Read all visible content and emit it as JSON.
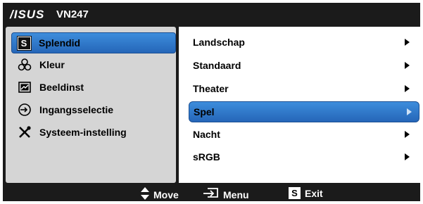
{
  "header": {
    "logo": "/ISUS",
    "model": "VN247"
  },
  "left_menu": {
    "items": [
      {
        "label": "Splendid",
        "icon": "splendid-s-icon",
        "selected": true
      },
      {
        "label": "Kleur",
        "icon": "color-icon",
        "selected": false
      },
      {
        "label": "Beeldinst",
        "icon": "image-icon",
        "selected": false
      },
      {
        "label": "Ingangsselectie",
        "icon": "input-icon",
        "selected": false
      },
      {
        "label": "Systeem-instelling",
        "icon": "tools-icon",
        "selected": false
      }
    ],
    "splendid_glyph": "S"
  },
  "right_menu": {
    "items": [
      {
        "label": "Landschap",
        "selected": false
      },
      {
        "label": "Standaard",
        "selected": false
      },
      {
        "label": "Theater",
        "selected": false
      },
      {
        "label": "Spel",
        "selected": true
      },
      {
        "label": "Nacht",
        "selected": false
      },
      {
        "label": "sRGB",
        "selected": false
      }
    ]
  },
  "footer": {
    "move_label": "Move",
    "menu_label": "Menu",
    "exit_label": "Exit",
    "exit_glyph": "S"
  },
  "colors": {
    "accent": "#2f7bd0",
    "panel": "#d5d5d5",
    "frame": "#1b1b1b"
  }
}
